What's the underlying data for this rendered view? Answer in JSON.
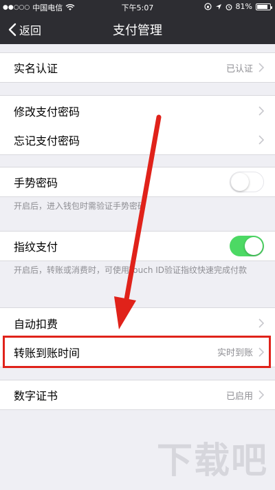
{
  "status_bar": {
    "signal_dots": "●●○○○",
    "carrier": "中国电信",
    "wifi_icon": "wifi-icon",
    "time": "下午5:07",
    "battery_percent": "81%",
    "battery_level": 0.81
  },
  "nav": {
    "back_label": "返回",
    "title": "支付管理"
  },
  "rows": {
    "real_name": {
      "label": "实名认证",
      "value": "已认证"
    },
    "change_password": {
      "label": "修改支付密码"
    },
    "forgot_password": {
      "label": "忘记支付密码"
    },
    "gesture_password": {
      "label": "手势密码",
      "toggle_on": false
    },
    "gesture_desc": "开启后，进入钱包时需验证手势密码",
    "fingerprint": {
      "label": "指纹支付",
      "toggle_on": true
    },
    "fingerprint_desc": "开启后，转账或消费时，可使用Touch ID验证指纹快速完成付款",
    "auto_deduct": {
      "label": "自动扣费"
    },
    "transfer_time": {
      "label": "转账到账时间",
      "value": "实时到账"
    },
    "digital_cert": {
      "label": "数字证书",
      "value": "已启用"
    }
  },
  "watermark": "下载吧",
  "colors": {
    "nav_bg": "#2d2d32",
    "page_bg": "#efeff4",
    "toggle_on": "#4cd964",
    "annotation_red": "#e0221a"
  }
}
